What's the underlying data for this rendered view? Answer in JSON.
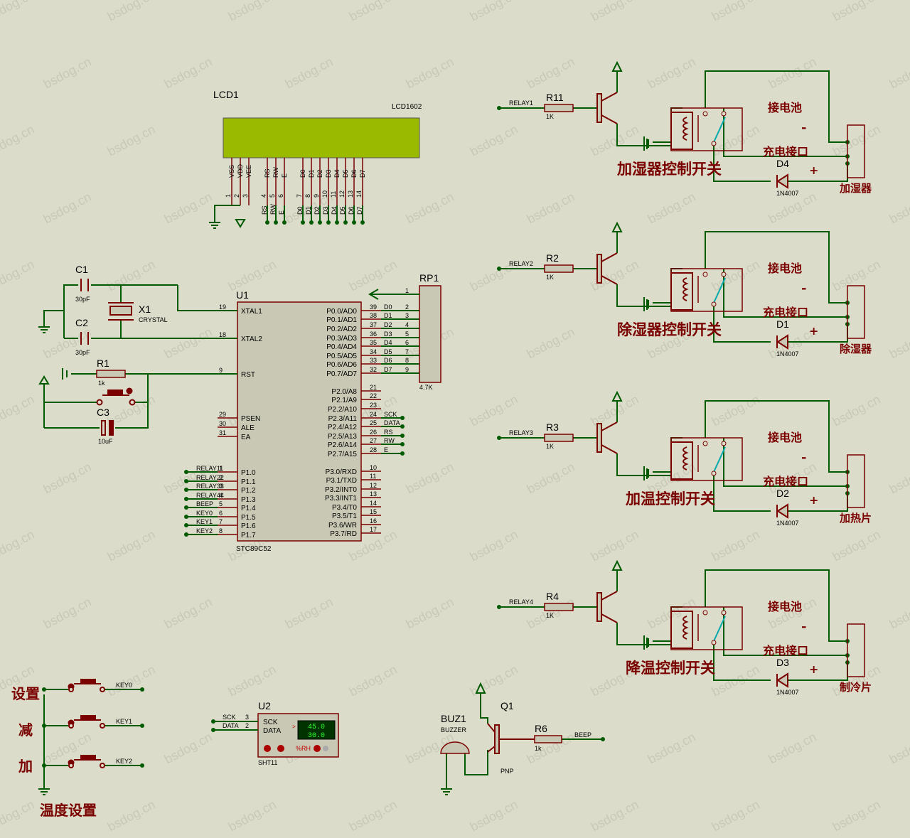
{
  "watermark": "bsdog.cn",
  "colors": {
    "background": "#dcdccb",
    "wire": "#005a00",
    "part": "#7a0000",
    "body": "#c8c8b4",
    "lcd_screen": "#9aba00"
  },
  "lcd": {
    "ref": "LCD1",
    "part": "LCD1602",
    "pins": [
      {
        "name": "VSS",
        "num": "1"
      },
      {
        "name": "VDD",
        "num": "2"
      },
      {
        "name": "VEE",
        "num": "3"
      },
      {
        "name": "RS",
        "num": "4"
      },
      {
        "name": "RW",
        "num": "5"
      },
      {
        "name": "E",
        "num": "6"
      },
      {
        "name": "D0",
        "num": "7"
      },
      {
        "name": "D1",
        "num": "8"
      },
      {
        "name": "D2",
        "num": "9"
      },
      {
        "name": "D3",
        "num": "10"
      },
      {
        "name": "D4",
        "num": "11"
      },
      {
        "name": "D5",
        "num": "12"
      },
      {
        "name": "D6",
        "num": "13"
      },
      {
        "name": "D7",
        "num": "14"
      }
    ],
    "net_labels": [
      "RS",
      "RW",
      "E",
      "D0",
      "D1",
      "D2",
      "D3",
      "D4",
      "D5",
      "D6",
      "D7"
    ]
  },
  "mcu": {
    "ref": "U1",
    "part": "STC89C52",
    "left_pins": [
      {
        "num": "19",
        "name": "XTAL1"
      },
      {
        "num": "18",
        "name": "XTAL2"
      },
      {
        "num": "9",
        "name": "RST"
      },
      {
        "num": "29",
        "name": "PSEN"
      },
      {
        "num": "30",
        "name": "ALE"
      },
      {
        "num": "31",
        "name": "EA"
      },
      {
        "num": "1",
        "name": "P1.0"
      },
      {
        "num": "2",
        "name": "P1.1"
      },
      {
        "num": "3",
        "name": "P1.2"
      },
      {
        "num": "4",
        "name": "P1.3"
      },
      {
        "num": "5",
        "name": "P1.4"
      },
      {
        "num": "6",
        "name": "P1.5"
      },
      {
        "num": "7",
        "name": "P1.6"
      },
      {
        "num": "8",
        "name": "P1.7"
      }
    ],
    "p1_nets": [
      "RELAY11",
      "RELAY22",
      "RELAY33",
      "RELAY44",
      "BEEP",
      "KEY0",
      "KEY1",
      "KEY2"
    ],
    "right_pins": [
      {
        "num": "39",
        "name": "P0.0/AD0",
        "net": "D0"
      },
      {
        "num": "38",
        "name": "P0.1/AD1",
        "net": "D1"
      },
      {
        "num": "37",
        "name": "P0.2/AD2",
        "net": "D2"
      },
      {
        "num": "36",
        "name": "P0.3/AD3",
        "net": "D3"
      },
      {
        "num": "35",
        "name": "P0.4/AD4",
        "net": "D4"
      },
      {
        "num": "34",
        "name": "P0.5/AD5",
        "net": "D5"
      },
      {
        "num": "33",
        "name": "P0.6/AD6",
        "net": "D6"
      },
      {
        "num": "32",
        "name": "P0.7/AD7",
        "net": "D7"
      },
      {
        "num": "21",
        "name": "P2.0/A8",
        "net": ""
      },
      {
        "num": "22",
        "name": "P2.1/A9",
        "net": ""
      },
      {
        "num": "23",
        "name": "P2.2/A10",
        "net": ""
      },
      {
        "num": "24",
        "name": "P2.3/A11",
        "net": "SCK"
      },
      {
        "num": "25",
        "name": "P2.4/A12",
        "net": "DATA"
      },
      {
        "num": "26",
        "name": "P2.5/A13",
        "net": "RS"
      },
      {
        "num": "27",
        "name": "P2.6/A14",
        "net": "RW"
      },
      {
        "num": "28",
        "name": "P2.7/A15",
        "net": "E"
      },
      {
        "num": "10",
        "name": "P3.0/RXD",
        "net": ""
      },
      {
        "num": "11",
        "name": "P3.1/TXD",
        "net": ""
      },
      {
        "num": "12",
        "name": "P3.2/INT0",
        "net": ""
      },
      {
        "num": "13",
        "name": "P3.3/INT1",
        "net": ""
      },
      {
        "num": "14",
        "name": "P3.4/T0",
        "net": ""
      },
      {
        "num": "15",
        "name": "P3.5/T1",
        "net": ""
      },
      {
        "num": "16",
        "name": "P3.6/WR",
        "net": ""
      },
      {
        "num": "17",
        "name": "P3.7/RD",
        "net": ""
      }
    ]
  },
  "rp1": {
    "ref": "RP1",
    "value": "4.7K",
    "pins": [
      "1",
      "2",
      "3",
      "4",
      "5",
      "6",
      "7",
      "8",
      "9"
    ]
  },
  "crystal": {
    "c1": "C1",
    "c1_val": "30pF",
    "c2": "C2",
    "c2_val": "30pF",
    "x1": "X1",
    "x1_val": "CRYSTAL"
  },
  "reset": {
    "r1": "R1",
    "r1_val": "1k",
    "c3": "C3",
    "c3_val": "10uF"
  },
  "relays": [
    {
      "net": "RELAY1",
      "r": "R11",
      "r_val": "1K",
      "diode": "D4",
      "diode_val": "1N4007",
      "title": "加湿器控制开关",
      "load": "加湿器"
    },
    {
      "net": "RELAY2",
      "r": "R2",
      "r_val": "1K",
      "diode": "D1",
      "diode_val": "1N4007",
      "title": "除湿器控制开关",
      "load": "除湿器"
    },
    {
      "net": "RELAY3",
      "r": "R3",
      "r_val": "1K",
      "diode": "D2",
      "diode_val": "1N4007",
      "title": "加温控制开关",
      "load": "加热片"
    },
    {
      "net": "RELAY4",
      "r": "R4",
      "r_val": "1K",
      "diode": "D3",
      "diode_val": "1N4007",
      "title": "降温控制开关",
      "load": "制冷片"
    }
  ],
  "relay_text": {
    "battery": "接电池",
    "charge": "充电接口",
    "minus": "-",
    "plus": "+"
  },
  "keys": {
    "nets": [
      "KEY0",
      "KEY1",
      "KEY2"
    ],
    "labels": [
      "设置",
      "减",
      "加"
    ],
    "title": "温度设置"
  },
  "sensor": {
    "ref": "U2",
    "part": "SHT11",
    "pins": [
      {
        "name": "SCK",
        "num": "3"
      },
      {
        "name": "DATA",
        "num": "2"
      }
    ],
    "display": [
      "45.0",
      "30.0"
    ],
    "unit": "%RH"
  },
  "buzzer": {
    "ref": "BUZ1",
    "part": "BUZZER",
    "q": "Q1",
    "q_type": "PNP",
    "r": "R6",
    "r_val": "1k",
    "net": "BEEP"
  }
}
